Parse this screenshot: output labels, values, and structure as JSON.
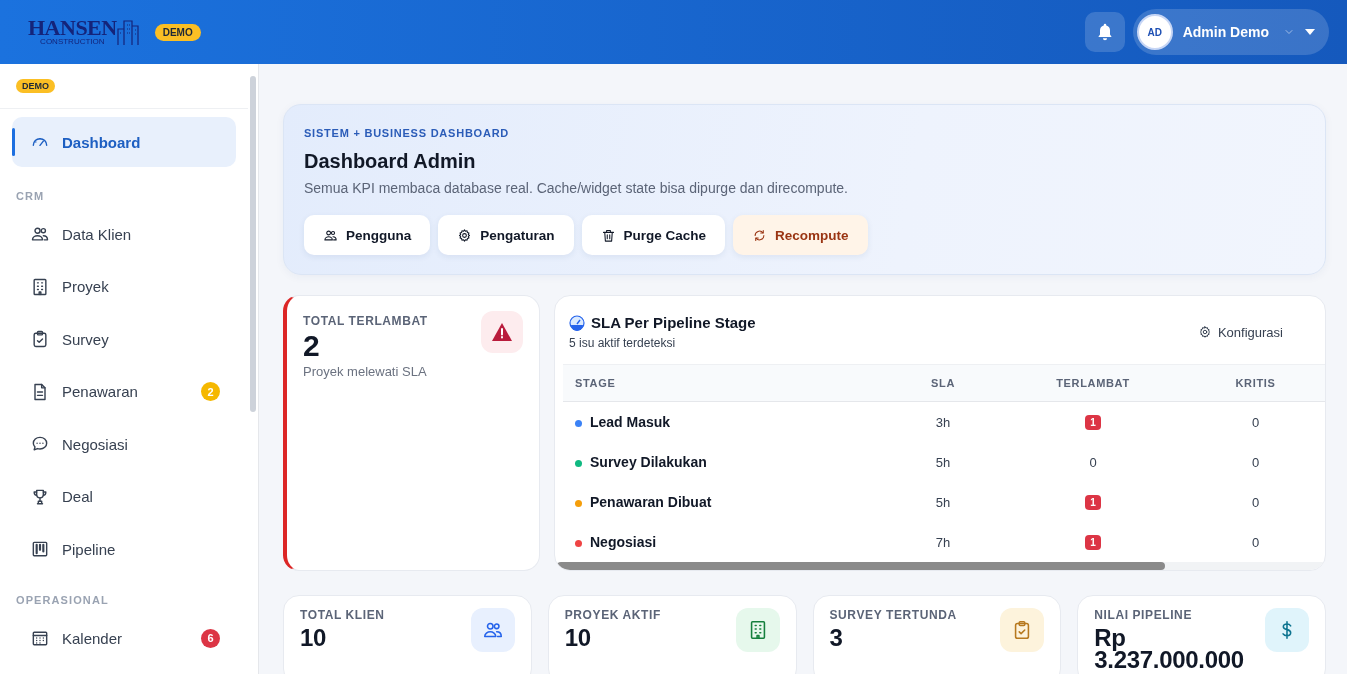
{
  "header": {
    "logo": {
      "name": "HANSEN",
      "tagline": "CONSTRUCTION"
    },
    "badge": "DEMO",
    "user": {
      "initials": "AD",
      "name": "Admin Demo"
    }
  },
  "sidebar": {
    "badge": "DEMO",
    "groups": [
      {
        "items": [
          {
            "label": "Dashboard",
            "selected": true
          }
        ]
      },
      {
        "heading": "CRM",
        "items": [
          {
            "label": "Data Klien",
            "selected": false
          },
          {
            "label": "Proyek",
            "selected": false
          },
          {
            "label": "Survey",
            "selected": false
          },
          {
            "label": "Penawaran",
            "selected": false,
            "badge": "2",
            "color": "#f5b800"
          },
          {
            "label": "Negosiasi",
            "selected": false
          },
          {
            "label": "Deal",
            "selected": false
          },
          {
            "label": "Pipeline",
            "selected": false
          }
        ]
      },
      {
        "heading": "OPERASIONAL",
        "items": [
          {
            "label": "Kalender",
            "selected": false,
            "badge": "6",
            "color": "#dc3545"
          }
        ]
      }
    ]
  },
  "hero": {
    "kicker": "SISTEM + BUSINESS DASHBOARD",
    "title": "Dashboard Admin",
    "description": "Semua KPI membaca database real. Cache/widget state bisa dipurge dan direcompute.",
    "buttons": [
      {
        "label": "Pengguna",
        "kind": "default"
      },
      {
        "label": "Pengaturan",
        "kind": "default"
      },
      {
        "label": "Purge Cache",
        "kind": "default"
      },
      {
        "label": "Recompute",
        "kind": "warning"
      }
    ]
  },
  "alert_card": {
    "label": "TOTAL TERLAMBAT",
    "value": "2",
    "note": "Proyek melewati SLA"
  },
  "sla": {
    "title": "SLA Per Pipeline Stage",
    "subtitle": "5 isu aktif terdeteksi",
    "action": "Konfigurasi",
    "columns": [
      "STAGE",
      "SLA",
      "TERLAMBAT",
      "KRITIS"
    ],
    "rows": [
      {
        "stage": "Lead Masuk",
        "color": "#3b82f6",
        "sla": "3h",
        "late": {
          "text": "1",
          "alert": true
        },
        "critical": "0"
      },
      {
        "stage": "Survey Dilakukan",
        "color": "#10b981",
        "sla": "5h",
        "late": {
          "text": "0",
          "alert": false
        },
        "critical": "0"
      },
      {
        "stage": "Penawaran Dibuat",
        "color": "#f59e0b",
        "sla": "5h",
        "late": {
          "text": "1",
          "alert": true
        },
        "critical": "0"
      },
      {
        "stage": "Negosiasi",
        "color": "#ef4444",
        "sla": "7h",
        "late": {
          "text": "1",
          "alert": true
        },
        "critical": "0"
      }
    ]
  },
  "stats": [
    {
      "label": "TOTAL KLIEN",
      "value": "10"
    },
    {
      "label": "PROYEK AKTIF",
      "value": "10"
    },
    {
      "label": "SURVEY TERTUNDA",
      "value": "3"
    },
    {
      "label": "NILAI PIPELINE",
      "value": "Rp 3.237.000.000"
    }
  ]
}
